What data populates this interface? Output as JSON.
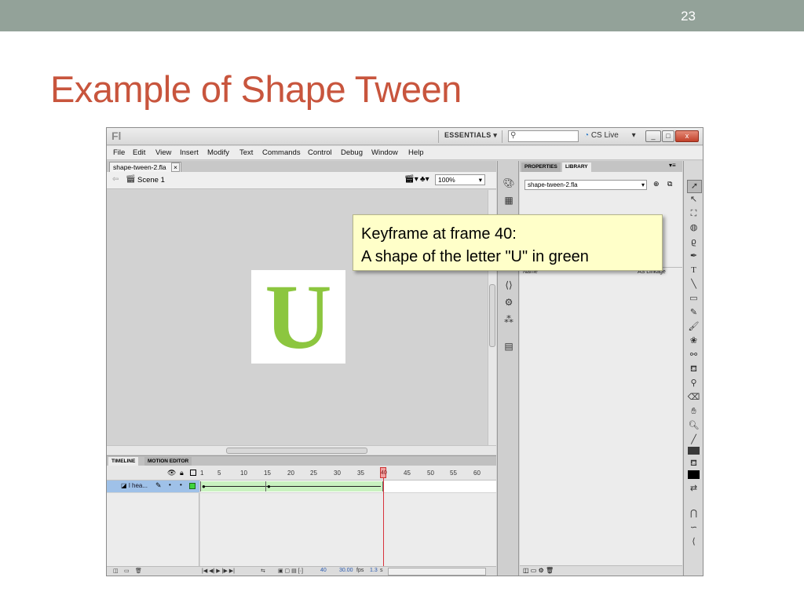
{
  "slide": {
    "number": "23",
    "title": "Example of Shape Tween"
  },
  "app": {
    "logo": "Fl",
    "workspace": "ESSENTIALS",
    "cs_live": "CS Live",
    "window_buttons": {
      "minimize": "_",
      "restore": "□",
      "close": "x"
    }
  },
  "menu": [
    "File",
    "Edit",
    "View",
    "Insert",
    "Modify",
    "Text",
    "Commands",
    "Control",
    "Debug",
    "Window",
    "Help"
  ],
  "document": {
    "tab_name": "shape-tween-2.fla",
    "scene": "Scene 1",
    "zoom": "100%",
    "stage_letter": "U"
  },
  "timeline": {
    "tabs": [
      "TIMELINE",
      "MOTION EDITOR"
    ],
    "ticks": [
      "1",
      "5",
      "10",
      "15",
      "20",
      "25",
      "30",
      "35",
      "40",
      "45",
      "50",
      "55",
      "60"
    ],
    "layer_name": "l hea...",
    "current_frame": 40,
    "fps": "30.00",
    "fps_unit": "fps",
    "time": "1.3",
    "time_unit": "s"
  },
  "panels": {
    "tabs": [
      "PROPERTIES",
      "LIBRARY"
    ],
    "library_file": "shape-tween-2.fla",
    "library_columns": {
      "name": "Name",
      "linkage": "AS Linkage"
    }
  },
  "callout": {
    "line1": "Keyframe at frame 40:",
    "line2": "A shape of the letter \"U\" in green"
  },
  "colors": {
    "slide_bar": "#93a299",
    "title": "#c8553d",
    "letter": "#8cc63f",
    "tween": "#c9f2c0",
    "playhead": "#d8323c",
    "callout_bg": "#ffffc9"
  }
}
